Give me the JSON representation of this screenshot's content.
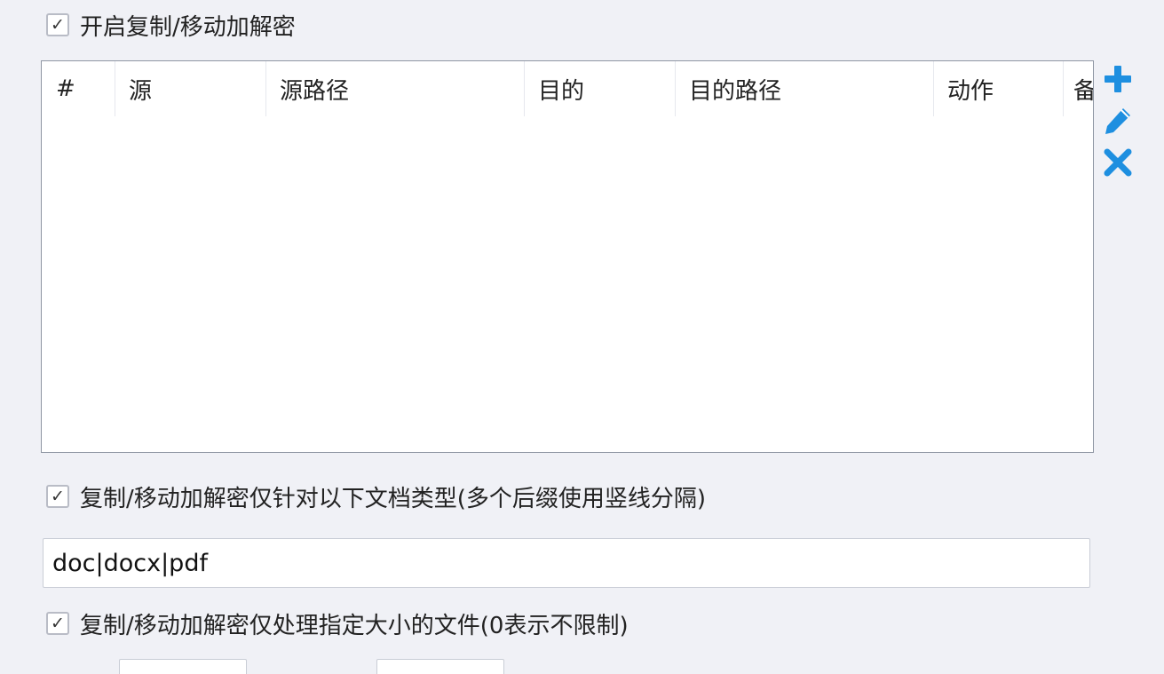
{
  "enable_encrypt": {
    "checked": true,
    "label": "开启复制/移动加解密"
  },
  "rules_table": {
    "columns": [
      "#",
      "源",
      "源路径",
      "目的",
      "目的路径",
      "动作",
      "备"
    ],
    "rows": []
  },
  "side_tools": {
    "add_icon": "plus-icon",
    "edit_icon": "pencil-icon",
    "delete_icon": "close-icon",
    "accent_color": "#1e8fe0"
  },
  "filter_types": {
    "checked": true,
    "label": "复制/移动加解密仅针对以下文档类型(多个后缀使用竖线分隔)",
    "value": "doc|docx|pdf"
  },
  "filter_size": {
    "checked": true,
    "label": "复制/移动加解密仅处理指定大小的文件(0表示不限制)"
  }
}
